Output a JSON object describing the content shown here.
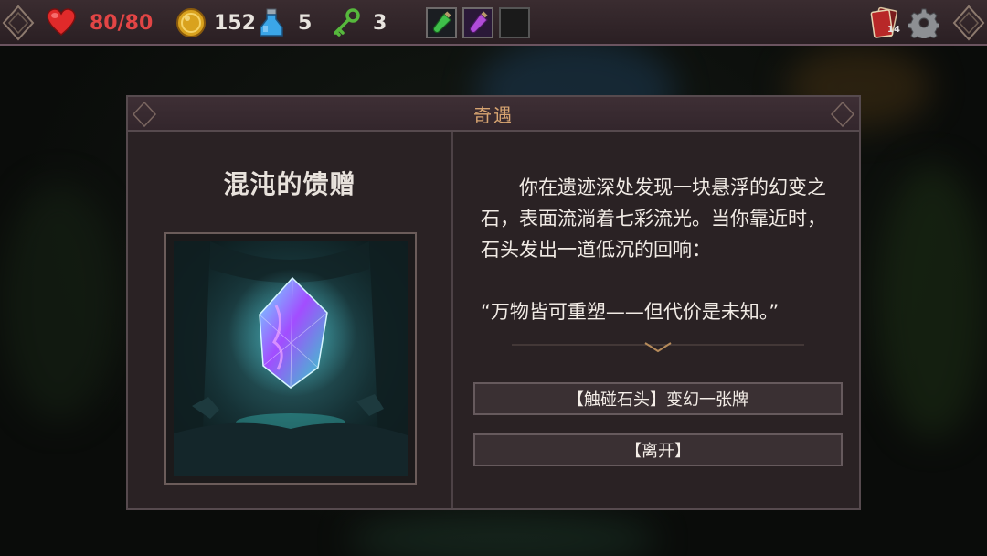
{
  "hud": {
    "hp": "80/80",
    "gold": "152",
    "potions": "5",
    "keys": "3",
    "deck_count": "14",
    "hp_color": "#e24545",
    "icons": [
      "heart-icon",
      "gold-coin-icon",
      "blue-potion-icon",
      "green-key-icon",
      "green-potion-slot-icon",
      "purple-potion-slot-icon",
      "card-deck-icon",
      "gear-icon"
    ]
  },
  "dialog": {
    "header": "奇遇",
    "event_title": "混沌的馈赠",
    "story": "你在遗迹深处发现一块悬浮的幻变之石，表面流淌着七彩流光。当你靠近时，石头发出一道低沉的回响：",
    "quote": "“万物皆可重塑——但代价是未知。”",
    "options": [
      {
        "label": "【触碰石头】变幻一张牌"
      },
      {
        "label": "【离开】"
      }
    ],
    "accent_color": "#d7a471"
  }
}
